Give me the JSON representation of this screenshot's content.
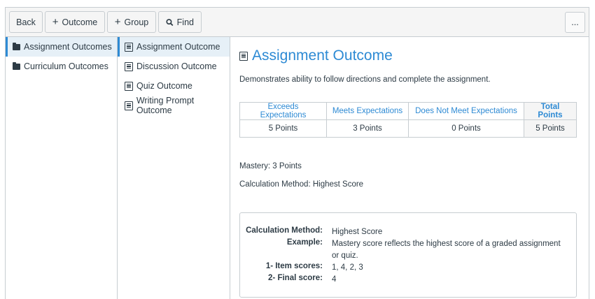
{
  "toolbar": {
    "back_label": "Back",
    "outcome_label": "Outcome",
    "group_label": "Group",
    "find_label": "Find",
    "more_label": "..."
  },
  "groups": [
    {
      "label": "Assignment Outcomes",
      "active": true
    },
    {
      "label": "Curriculum Outcomes",
      "active": false
    }
  ],
  "outcomes": [
    {
      "label": "Assignment Outcome",
      "active": true
    },
    {
      "label": "Discussion Outcome",
      "active": false
    },
    {
      "label": "Quiz Outcome",
      "active": false
    },
    {
      "label": "Writing Prompt Outcome",
      "active": false
    }
  ],
  "detail": {
    "title": "Assignment Outcome",
    "description": "Demonstrates ability to follow directions and complete the assignment.",
    "ratings": [
      {
        "label": "Exceeds Expectations",
        "points": "5 Points"
      },
      {
        "label": "Meets Expectations",
        "points": "3 Points"
      },
      {
        "label": "Does Not Meet Expectations",
        "points": "0 Points"
      }
    ],
    "total": {
      "label": "Total Points",
      "points": "5 Points"
    },
    "mastery": "Mastery: 3 Points",
    "calculation_method": "Calculation Method: Highest Score",
    "calc_box": {
      "method_key": "Calculation Method:",
      "method_value": "Highest Score",
      "example_key": "Example:",
      "example_value": "Mastery score reflects the highest score of a graded assignment or quiz.",
      "item_scores_key": "1- Item scores:",
      "item_scores_value": "1, 4, 2, 3",
      "final_score_key": "2- Final score:",
      "final_score_value": "4"
    }
  },
  "colors": {
    "accent": "#2d8ad4",
    "text": "#2d3b45",
    "border": "#c7cdd1",
    "active_bg": "#e6f0f7"
  }
}
